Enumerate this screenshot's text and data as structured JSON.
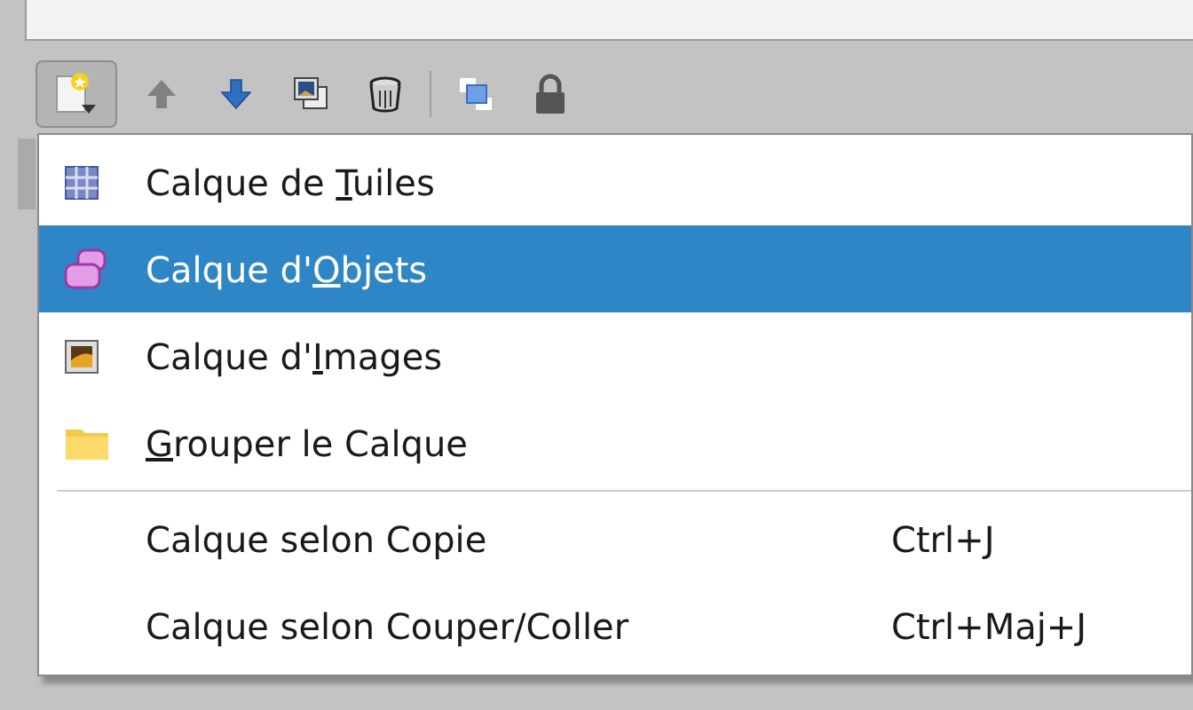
{
  "toolbar": {
    "groups": [
      [
        {
          "kind": "new-layer",
          "disabled": false,
          "pressed": true
        },
        {
          "kind": "up",
          "disabled": true,
          "pressed": false
        },
        {
          "kind": "down",
          "disabled": false,
          "pressed": false
        },
        {
          "kind": "duplicate",
          "disabled": false,
          "pressed": false
        },
        {
          "kind": "delete",
          "disabled": false,
          "pressed": false
        }
      ],
      [
        {
          "kind": "highlight",
          "disabled": false,
          "pressed": false
        },
        {
          "kind": "lock",
          "disabled": false,
          "pressed": false
        }
      ]
    ]
  },
  "menu": {
    "items": [
      {
        "kind": "tiles",
        "label": {
          "before": "Calque de ",
          "key": "T",
          "after": "uiles"
        },
        "selected": false
      },
      {
        "kind": "objects",
        "label": {
          "before": "Calque d'",
          "key": "O",
          "after": "bjets"
        },
        "selected": true
      },
      {
        "kind": "image",
        "label": {
          "before": "Calque d'",
          "key": "I",
          "after": "mages"
        },
        "selected": false
      },
      {
        "kind": "folder",
        "label": {
          "key": "G",
          "after": "rouper le Calque"
        },
        "selected": false
      },
      {
        "kind": "separator"
      },
      {
        "kind": "plain",
        "label": {
          "before": "Calque selon Copie"
        },
        "shortcut": "Ctrl+J",
        "selected": false
      },
      {
        "kind": "plain",
        "label": {
          "before": "Calque selon Couper/Coller"
        },
        "shortcut": "Ctrl+Maj+J",
        "selected": false
      }
    ]
  }
}
